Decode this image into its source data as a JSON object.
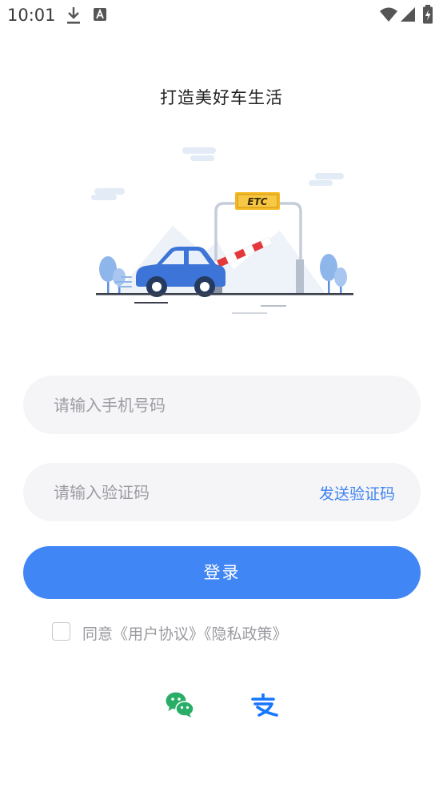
{
  "status_bar": {
    "time": "10:01",
    "icons": [
      "download-icon",
      "a-notification-icon",
      "wifi-icon",
      "signal-icon",
      "battery-icon"
    ]
  },
  "slogan": "打造美好车生活",
  "hero": {
    "sign_text": "ETC",
    "icon": "car-passing-etc-gate-illustration"
  },
  "phone_field": {
    "value": "",
    "placeholder": "请输入手机号码"
  },
  "code_field": {
    "value": "",
    "placeholder": "请输入验证码",
    "send_code_label": "发送验证码"
  },
  "login_button": {
    "label": "登录"
  },
  "agreement": {
    "checked": false,
    "text": "同意《用户协议》《隐私政策》"
  },
  "social_login": {
    "wechat_icon": "wechat-icon",
    "alipay_icon": "alipay-icon"
  },
  "colors": {
    "accent": "#4186f5",
    "link": "#3f83f0",
    "input_bg": "#f5f5f8",
    "wechat": "#2aae67",
    "alipay": "#1677ff"
  }
}
